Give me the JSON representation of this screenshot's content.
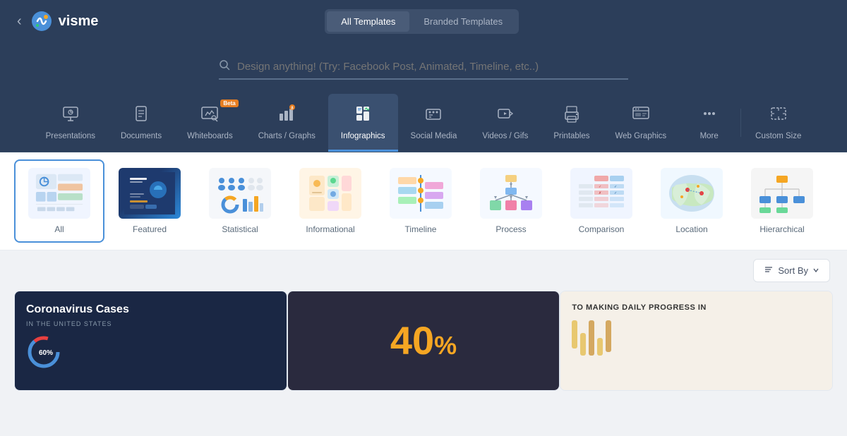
{
  "header": {
    "back_label": "‹",
    "logo_text": "visme",
    "tabs": [
      {
        "id": "all",
        "label": "All Templates",
        "active": true
      },
      {
        "id": "branded",
        "label": "Branded Templates",
        "active": false
      }
    ]
  },
  "search": {
    "placeholder": "Design anything! (Try: Facebook Post, Animated, Timeline, etc..)"
  },
  "categories": [
    {
      "id": "presentations",
      "label": "Presentations",
      "icon": "presentation"
    },
    {
      "id": "documents",
      "label": "Documents",
      "icon": "document"
    },
    {
      "id": "whiteboards",
      "label": "Whiteboards",
      "icon": "whiteboard",
      "badge": "Beta"
    },
    {
      "id": "charts",
      "label": "Charts / Graphs",
      "icon": "chart"
    },
    {
      "id": "infographics",
      "label": "Infographics",
      "icon": "infographic",
      "active": true
    },
    {
      "id": "social",
      "label": "Social Media",
      "icon": "social"
    },
    {
      "id": "videos",
      "label": "Videos / Gifs",
      "icon": "video"
    },
    {
      "id": "printables",
      "label": "Printables",
      "icon": "print"
    },
    {
      "id": "web",
      "label": "Web Graphics",
      "icon": "web"
    },
    {
      "id": "more",
      "label": "More",
      "icon": "more"
    },
    {
      "id": "custom",
      "label": "Custom Size",
      "icon": "custom"
    }
  ],
  "types": [
    {
      "id": "all",
      "label": "All",
      "selected": true
    },
    {
      "id": "featured",
      "label": "Featured"
    },
    {
      "id": "statistical",
      "label": "Statistical"
    },
    {
      "id": "informational",
      "label": "Informational"
    },
    {
      "id": "timeline",
      "label": "Timeline"
    },
    {
      "id": "process",
      "label": "Process"
    },
    {
      "id": "comparison",
      "label": "Comparison"
    },
    {
      "id": "location",
      "label": "Location"
    },
    {
      "id": "hierarchical",
      "label": "Hierarchical"
    }
  ],
  "sort": {
    "label": "Sort By",
    "icon": "sort-icon"
  },
  "templates": [
    {
      "id": "covid",
      "title": "Coronavirus Cases",
      "subtitle": "IN THE UNITED STATES",
      "type": "dark"
    },
    {
      "id": "percent",
      "value": "40",
      "symbol": "%",
      "type": "percent"
    },
    {
      "id": "progress",
      "heading": "TO MAKING DAILY PROGRESS IN",
      "type": "progress"
    }
  ]
}
